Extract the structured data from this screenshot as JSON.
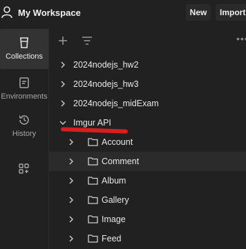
{
  "header": {
    "workspace_title": "My Workspace",
    "new_label": "New",
    "import_label": "Import"
  },
  "sidebar": {
    "items": [
      {
        "label": "Collections",
        "icon": "trash-bin-icon",
        "active": true
      },
      {
        "label": "Environments",
        "icon": "environment-icon",
        "active": false
      },
      {
        "label": "History",
        "icon": "history-icon",
        "active": false
      },
      {
        "label": "",
        "icon": "add-apps-icon",
        "active": false
      }
    ]
  },
  "toolbar": {
    "add_icon": "plus-icon",
    "filter_icon": "filter-lines-icon",
    "more_icon": "more-horizontal-icon"
  },
  "collections": [
    {
      "name": "2024nodejs_hw2",
      "expanded": false
    },
    {
      "name": "2024nodejs_hw3",
      "expanded": false
    },
    {
      "name": "2024nodejs_midExam",
      "expanded": false
    },
    {
      "name": "Imgur API",
      "expanded": true,
      "highlighted": true,
      "folders": [
        "Account",
        "Comment",
        "Album",
        "Gallery",
        "Image",
        "Feed"
      ]
    }
  ],
  "colors": {
    "background": "#212121",
    "active_sidebar": "#333333",
    "annotation": "#d81e1e"
  }
}
